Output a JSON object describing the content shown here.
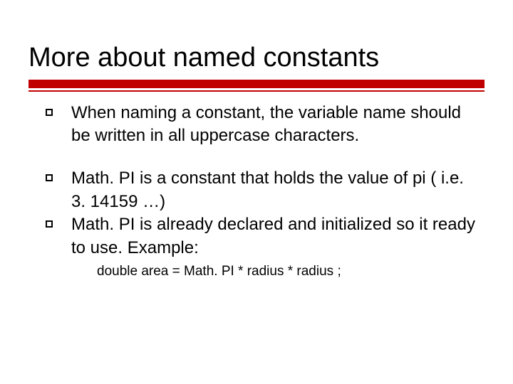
{
  "title": "More about named constants",
  "bullets": [
    {
      "text": "When naming a constant, the variable name should be written in all uppercase characters."
    },
    {
      "text": "Math. PI is a constant that holds the value of pi ( i.e. 3. 14159 …)"
    },
    {
      "text": "Math. PI is already declared and initialized so it ready to use. Example:"
    }
  ],
  "example": "double area = Math. PI * radius * radius ;"
}
